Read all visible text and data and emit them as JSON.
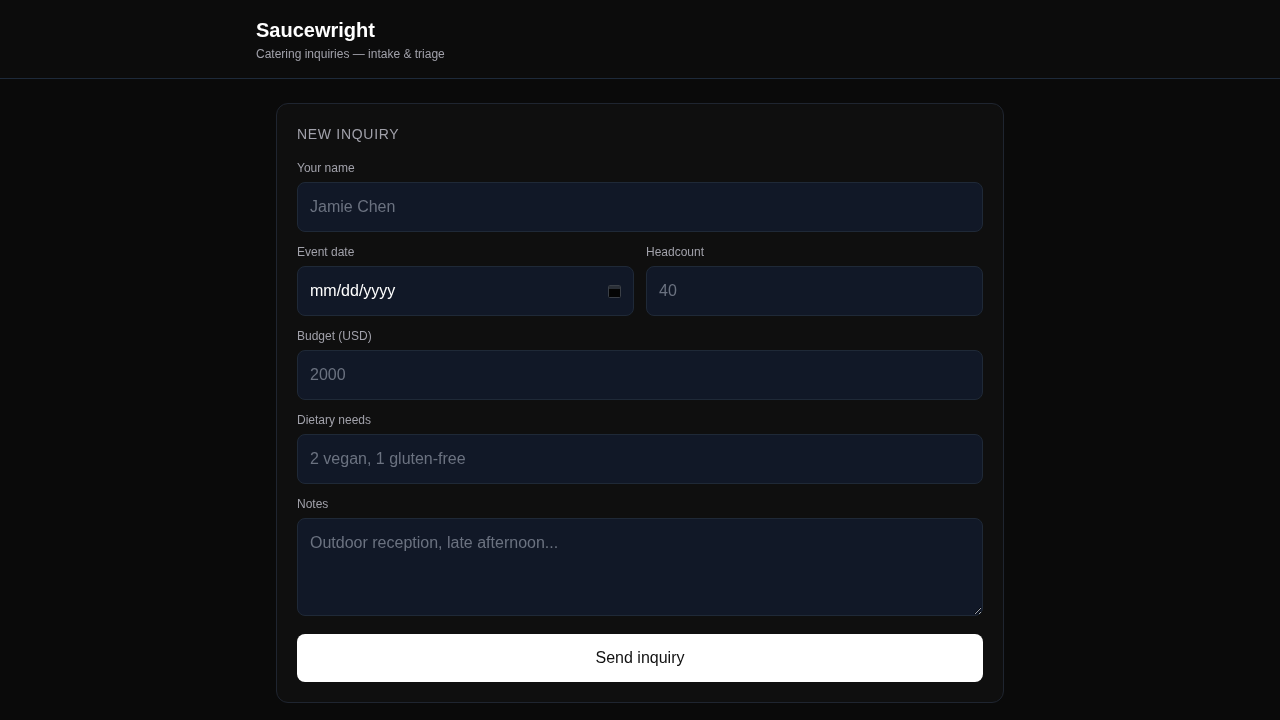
{
  "header": {
    "title": "Saucewright",
    "subtitle": "Catering inquiries — intake & triage"
  },
  "form": {
    "heading": "NEW INQUIRY",
    "rows": [
      [
        {
          "kind": "text",
          "label": "Your name",
          "placeholder": "Jamie Chen"
        }
      ],
      [
        {
          "kind": "date",
          "label": "Event date",
          "value": "mm/dd/yyyy"
        },
        {
          "kind": "number",
          "label": "Headcount",
          "placeholder": "40"
        }
      ],
      [
        {
          "kind": "number",
          "label": "Budget (USD)",
          "placeholder": "2000"
        }
      ],
      [
        {
          "kind": "text",
          "label": "Dietary needs",
          "placeholder": "2 vegan, 1 gluten-free"
        }
      ],
      [
        {
          "kind": "textarea",
          "label": "Notes",
          "placeholder": "Outdoor reception, late afternoon..."
        }
      ]
    ],
    "submit": "Send inquiry"
  }
}
